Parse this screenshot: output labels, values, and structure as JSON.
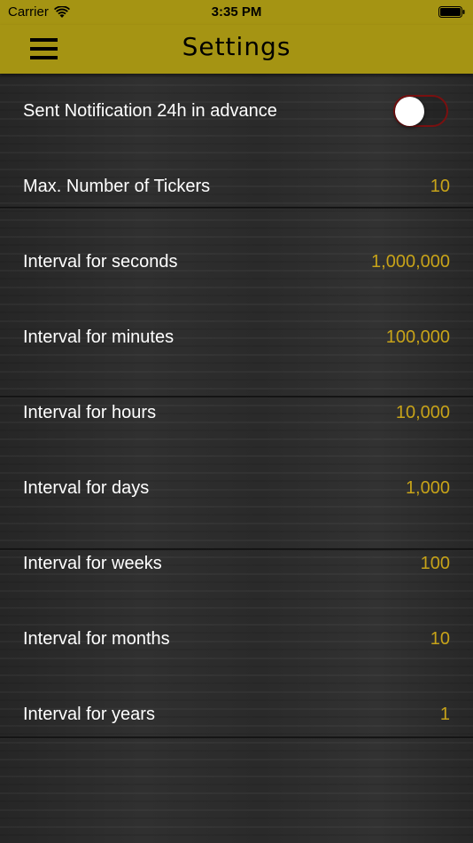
{
  "status_bar": {
    "carrier": "Carrier",
    "time": "3:35 PM",
    "wifi_icon": "wifi-icon",
    "battery_icon": "battery-icon"
  },
  "nav": {
    "title": "Settings",
    "menu_icon": "hamburger-menu-icon"
  },
  "colors": {
    "accent_bar": "#a59413",
    "value_text": "#c7a319",
    "label_text": "#ffffff",
    "toggle_border": "#7a1010"
  },
  "settings": {
    "notification": {
      "label": "Sent Notification 24h in advance",
      "enabled": false
    },
    "max_tickers": {
      "label": "Max. Number of Tickers",
      "value": "10"
    },
    "seconds": {
      "label": "Interval for seconds",
      "value": "1,000,000"
    },
    "minutes": {
      "label": "Interval for minutes",
      "value": "100,000"
    },
    "hours": {
      "label": "Interval for hours",
      "value": "10,000"
    },
    "days": {
      "label": "Interval for days",
      "value": "1,000"
    },
    "weeks": {
      "label": "Interval for weeks",
      "value": "100"
    },
    "months": {
      "label": "Interval for months",
      "value": "10"
    },
    "years": {
      "label": "Interval for years",
      "value": "1"
    }
  }
}
